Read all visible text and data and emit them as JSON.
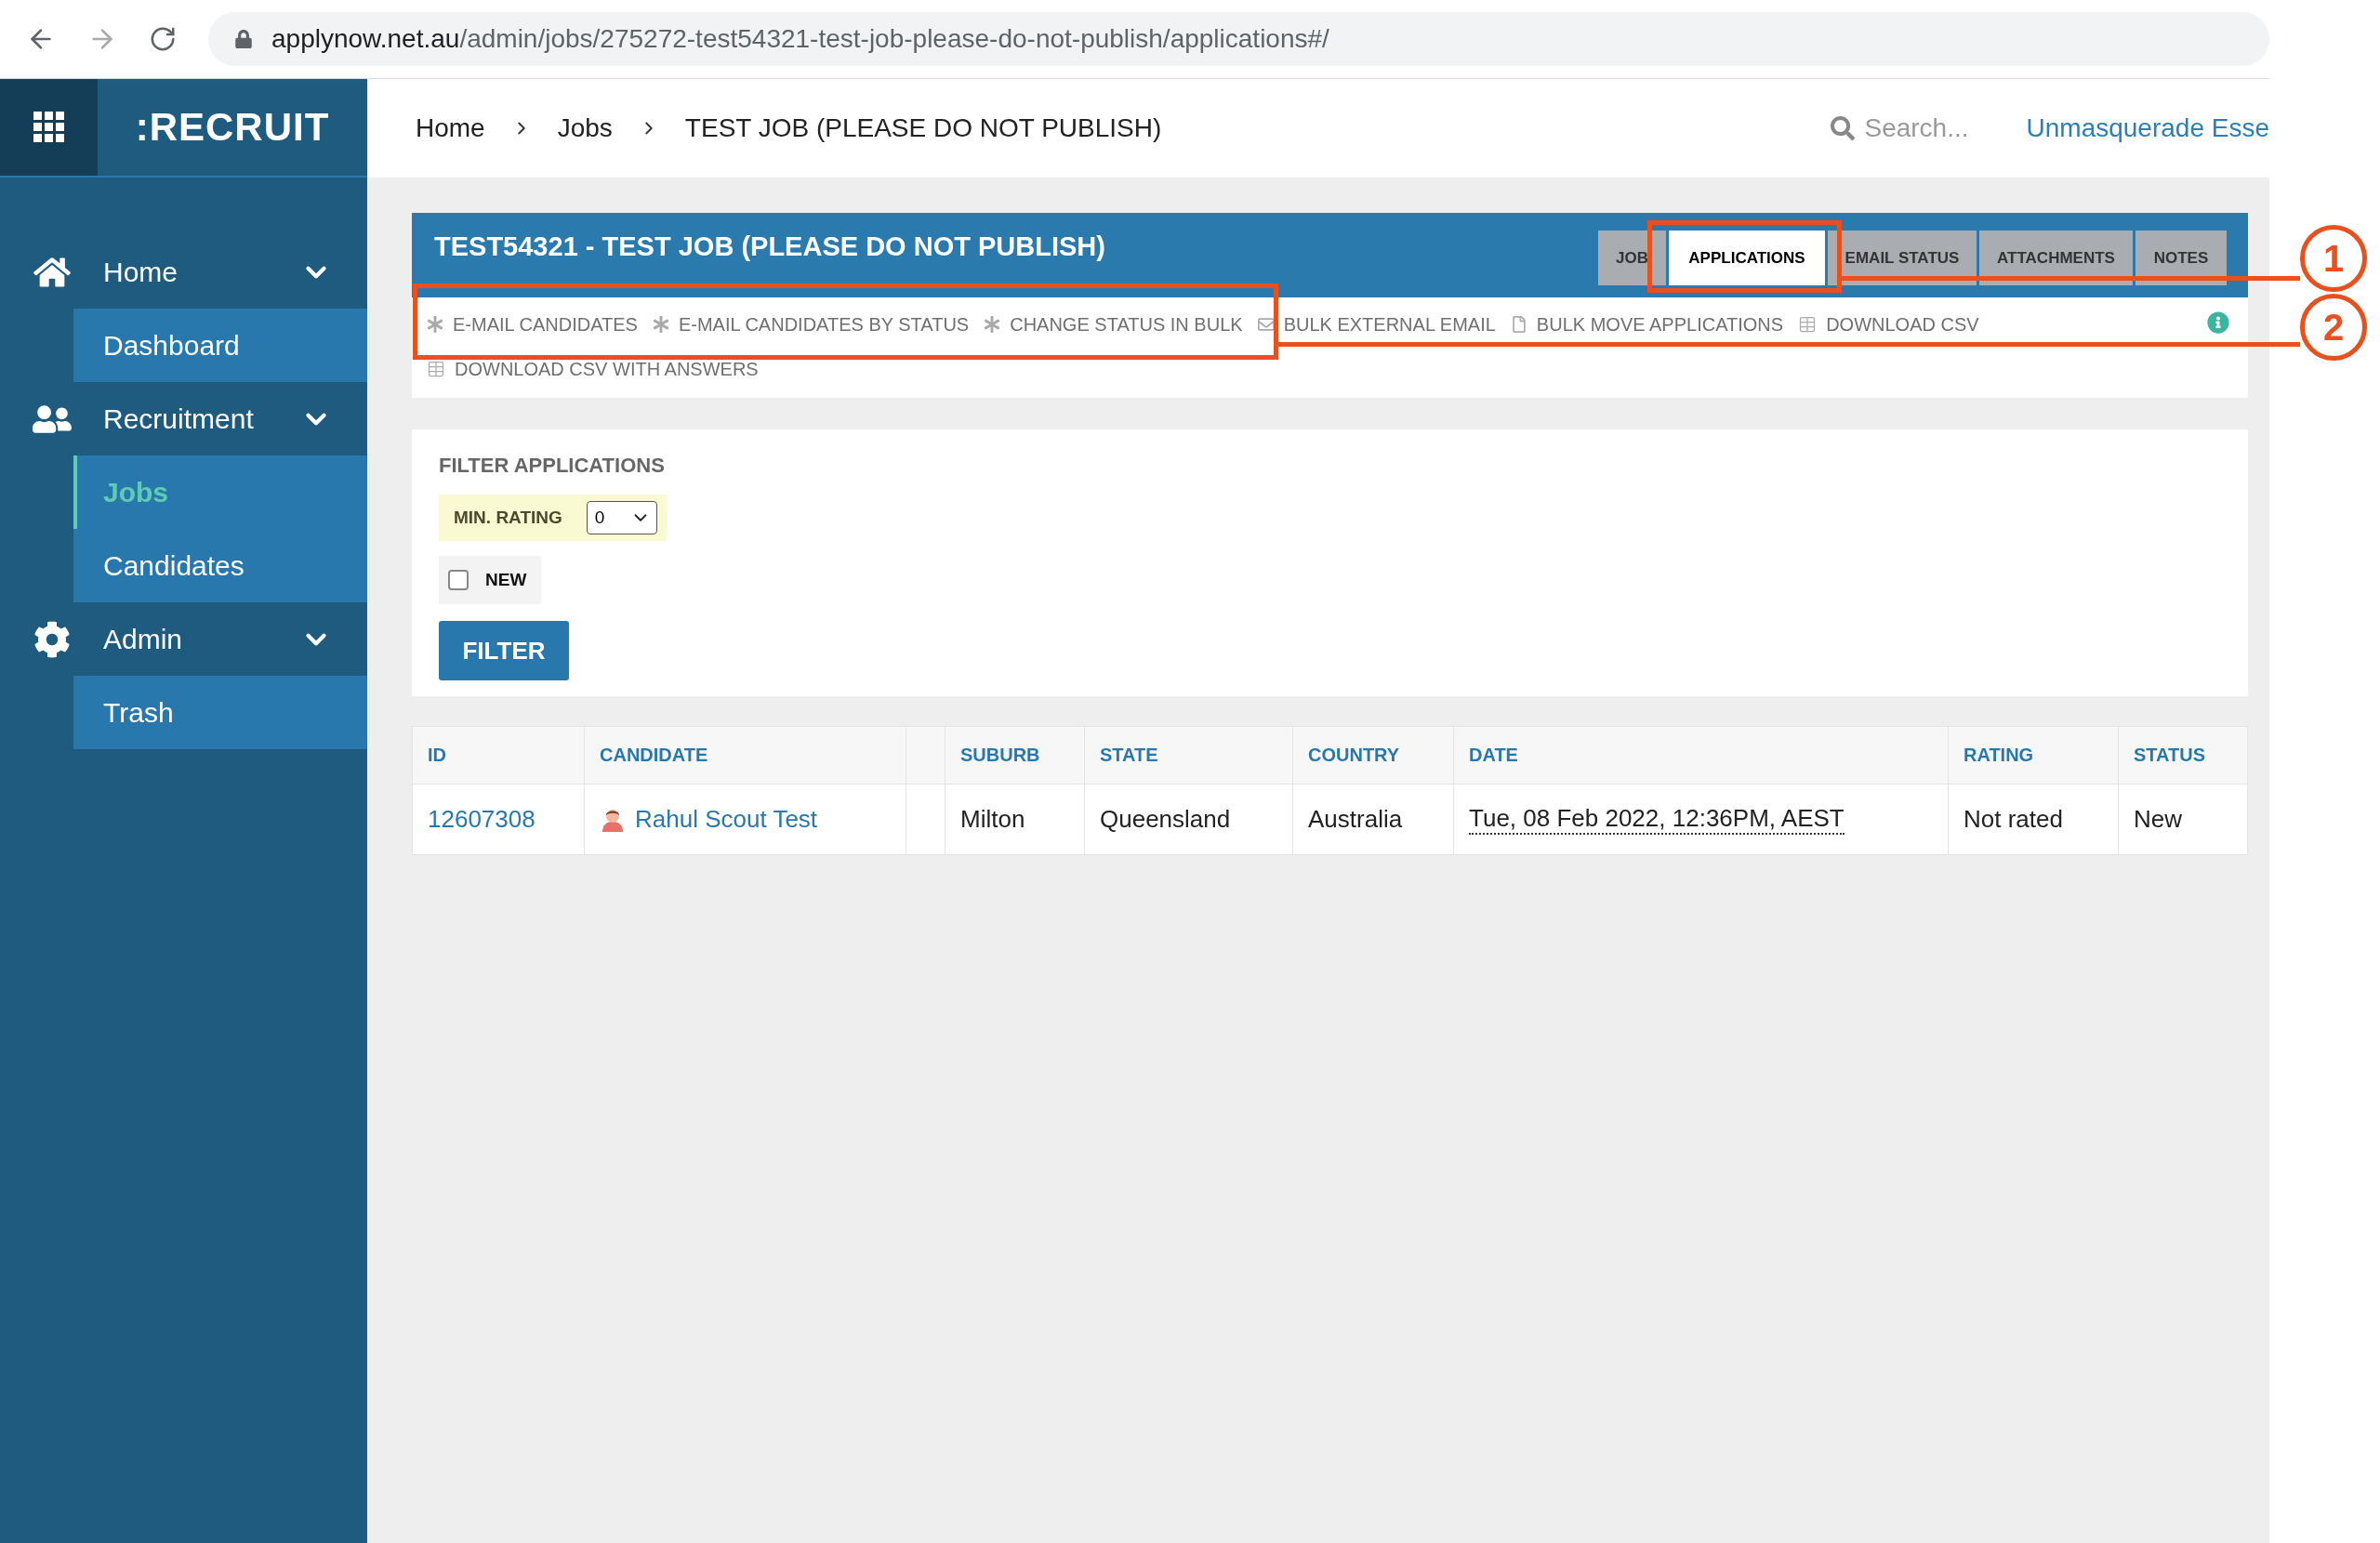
{
  "browser": {
    "url_host": "applynow.net.au",
    "url_path": "/admin/jobs/275272-test54321-test-job-please-do-not-publish/applications#/"
  },
  "sidebar": {
    "logo": ":RECRUIT",
    "sections": [
      {
        "label": "Home",
        "expanded": true,
        "children": [
          {
            "label": "Dashboard",
            "selected": false
          }
        ]
      },
      {
        "label": "Recruitment",
        "expanded": true,
        "children": [
          {
            "label": "Jobs",
            "selected": true
          },
          {
            "label": "Candidates",
            "selected": false
          }
        ]
      },
      {
        "label": "Admin",
        "expanded": true,
        "children": [
          {
            "label": "Trash",
            "selected": false
          }
        ]
      }
    ]
  },
  "topbar": {
    "breadcrumb": [
      "Home",
      "Jobs",
      "TEST JOB (PLEASE DO NOT PUBLISH)"
    ],
    "search_placeholder": "Search...",
    "user_link": "Unmasquerade Esse"
  },
  "panel": {
    "title": "TEST54321 - TEST JOB (PLEASE DO NOT PUBLISH)",
    "tabs": [
      {
        "label": "JOB",
        "selected": false
      },
      {
        "label": "APPLICATIONS",
        "selected": true
      },
      {
        "label": "EMAIL STATUS",
        "selected": false
      },
      {
        "label": "ATTACHMENTS",
        "selected": false
      },
      {
        "label": "NOTES",
        "selected": false
      }
    ],
    "actions": [
      "E-MAIL CANDIDATES",
      "E-MAIL CANDIDATES BY STATUS",
      "CHANGE STATUS IN BULK",
      "BULK EXTERNAL EMAIL",
      "BULK MOVE APPLICATIONS",
      "DOWNLOAD CSV",
      "DOWNLOAD CSV WITH ANSWERS"
    ]
  },
  "filter": {
    "heading": "FILTER APPLICATIONS",
    "min_rating_label": "MIN. RATING",
    "min_rating_value": "0",
    "new_label": "NEW",
    "new_checked": false,
    "button": "FILTER"
  },
  "table": {
    "columns": [
      {
        "kind": "link",
        "label": "ID"
      },
      {
        "kind": "person",
        "label": "CANDIDATE"
      },
      {
        "kind": "blank"
      },
      {
        "kind": "text",
        "label": "SUBURB"
      },
      {
        "kind": "text",
        "label": "STATE"
      },
      {
        "kind": "text",
        "label": "COUNTRY"
      },
      {
        "kind": "date",
        "label": "DATE"
      },
      {
        "kind": "text",
        "label": "RATING"
      },
      {
        "kind": "text",
        "label": "STATUS"
      }
    ],
    "rows": [
      {
        "cells": [
          "12607308",
          "Rahul Scout Test",
          "",
          "Milton",
          "Queensland",
          "Australia",
          "Tue, 08 Feb 2022, 12:36PM, AEST",
          "Not rated",
          "New"
        ]
      }
    ]
  },
  "annotations": [
    {
      "number": "1"
    },
    {
      "number": "2"
    }
  ]
}
